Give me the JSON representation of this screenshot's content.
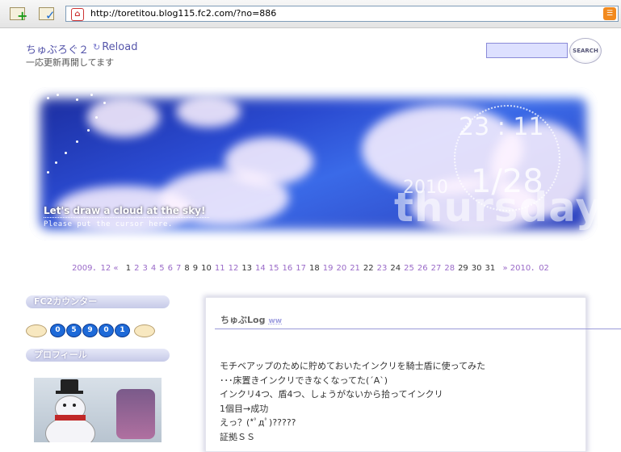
{
  "browser": {
    "url": "http://toretitou.blog115.fc2.com/?no=886",
    "site_icon": "fc2-icon",
    "feed_icon": "rss-icon"
  },
  "blog": {
    "title": "ちゅぶろぐ２",
    "reload_label": "Reload",
    "subtitle": "一応更新再開してます",
    "search_button": "SEARCH"
  },
  "banner": {
    "tagline": "Let's draw a cloud at the sky!",
    "subtext": "Please put the cursor here.",
    "year": "2010",
    "date": "1/28",
    "day": "thursday",
    "time": "23 : 11"
  },
  "calendar": {
    "prev": "2009．12 «",
    "next": "» 2010．02",
    "days": [
      "1",
      "2",
      "3",
      "4",
      "5",
      "6",
      "7",
      "8",
      "9",
      "10",
      "11",
      "12",
      "13",
      "14",
      "15",
      "16",
      "17",
      "18",
      "19",
      "20",
      "21",
      "22",
      "23",
      "24",
      "25",
      "26",
      "27",
      "28",
      "29",
      "30",
      "31"
    ],
    "linked_days": [
      "2",
      "3",
      "4",
      "5",
      "6",
      "7",
      "11",
      "12",
      "14",
      "15",
      "16",
      "17",
      "19",
      "20",
      "21",
      "23",
      "25",
      "26",
      "27",
      "28"
    ]
  },
  "sidebar": {
    "counter_heading": "FC2カウンター",
    "counter_digits": [
      "0",
      "5",
      "9",
      "0",
      "1"
    ],
    "profile_heading": "プロフィール"
  },
  "post": {
    "title": "ちゅぶLog",
    "title_mark": "ww",
    "lines": [
      "モチベアップのために貯めておいたインクリを騎士盾に使ってみた",
      "･･･床置きインクリできなくなってた(´A`)",
      "インクリ4つ、盾4つ、しょうがないから拾ってインクリ",
      "1個目→成功",
      "えっ？(*ﾟдﾟ)?????",
      "証拠ＳＳ"
    ]
  },
  "colors": {
    "accent": "#5555aa",
    "link": "#9a6ac8",
    "sky": "#2a4ad0"
  }
}
